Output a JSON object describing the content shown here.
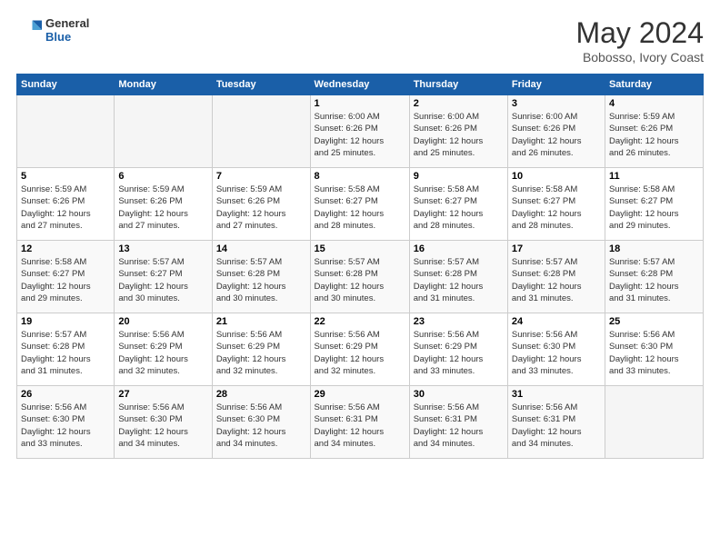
{
  "logo": {
    "general": "General",
    "blue": "Blue"
  },
  "header": {
    "month_year": "May 2024",
    "location": "Bobosso, Ivory Coast"
  },
  "days_of_week": [
    "Sunday",
    "Monday",
    "Tuesday",
    "Wednesday",
    "Thursday",
    "Friday",
    "Saturday"
  ],
  "weeks": [
    [
      {
        "day": "",
        "info": ""
      },
      {
        "day": "",
        "info": ""
      },
      {
        "day": "",
        "info": ""
      },
      {
        "day": "1",
        "info": "Sunrise: 6:00 AM\nSunset: 6:26 PM\nDaylight: 12 hours\nand 25 minutes."
      },
      {
        "day": "2",
        "info": "Sunrise: 6:00 AM\nSunset: 6:26 PM\nDaylight: 12 hours\nand 25 minutes."
      },
      {
        "day": "3",
        "info": "Sunrise: 6:00 AM\nSunset: 6:26 PM\nDaylight: 12 hours\nand 26 minutes."
      },
      {
        "day": "4",
        "info": "Sunrise: 5:59 AM\nSunset: 6:26 PM\nDaylight: 12 hours\nand 26 minutes."
      }
    ],
    [
      {
        "day": "5",
        "info": "Sunrise: 5:59 AM\nSunset: 6:26 PM\nDaylight: 12 hours\nand 27 minutes."
      },
      {
        "day": "6",
        "info": "Sunrise: 5:59 AM\nSunset: 6:26 PM\nDaylight: 12 hours\nand 27 minutes."
      },
      {
        "day": "7",
        "info": "Sunrise: 5:59 AM\nSunset: 6:26 PM\nDaylight: 12 hours\nand 27 minutes."
      },
      {
        "day": "8",
        "info": "Sunrise: 5:58 AM\nSunset: 6:27 PM\nDaylight: 12 hours\nand 28 minutes."
      },
      {
        "day": "9",
        "info": "Sunrise: 5:58 AM\nSunset: 6:27 PM\nDaylight: 12 hours\nand 28 minutes."
      },
      {
        "day": "10",
        "info": "Sunrise: 5:58 AM\nSunset: 6:27 PM\nDaylight: 12 hours\nand 28 minutes."
      },
      {
        "day": "11",
        "info": "Sunrise: 5:58 AM\nSunset: 6:27 PM\nDaylight: 12 hours\nand 29 minutes."
      }
    ],
    [
      {
        "day": "12",
        "info": "Sunrise: 5:58 AM\nSunset: 6:27 PM\nDaylight: 12 hours\nand 29 minutes."
      },
      {
        "day": "13",
        "info": "Sunrise: 5:57 AM\nSunset: 6:27 PM\nDaylight: 12 hours\nand 30 minutes."
      },
      {
        "day": "14",
        "info": "Sunrise: 5:57 AM\nSunset: 6:28 PM\nDaylight: 12 hours\nand 30 minutes."
      },
      {
        "day": "15",
        "info": "Sunrise: 5:57 AM\nSunset: 6:28 PM\nDaylight: 12 hours\nand 30 minutes."
      },
      {
        "day": "16",
        "info": "Sunrise: 5:57 AM\nSunset: 6:28 PM\nDaylight: 12 hours\nand 31 minutes."
      },
      {
        "day": "17",
        "info": "Sunrise: 5:57 AM\nSunset: 6:28 PM\nDaylight: 12 hours\nand 31 minutes."
      },
      {
        "day": "18",
        "info": "Sunrise: 5:57 AM\nSunset: 6:28 PM\nDaylight: 12 hours\nand 31 minutes."
      }
    ],
    [
      {
        "day": "19",
        "info": "Sunrise: 5:57 AM\nSunset: 6:28 PM\nDaylight: 12 hours\nand 31 minutes."
      },
      {
        "day": "20",
        "info": "Sunrise: 5:56 AM\nSunset: 6:29 PM\nDaylight: 12 hours\nand 32 minutes."
      },
      {
        "day": "21",
        "info": "Sunrise: 5:56 AM\nSunset: 6:29 PM\nDaylight: 12 hours\nand 32 minutes."
      },
      {
        "day": "22",
        "info": "Sunrise: 5:56 AM\nSunset: 6:29 PM\nDaylight: 12 hours\nand 32 minutes."
      },
      {
        "day": "23",
        "info": "Sunrise: 5:56 AM\nSunset: 6:29 PM\nDaylight: 12 hours\nand 33 minutes."
      },
      {
        "day": "24",
        "info": "Sunrise: 5:56 AM\nSunset: 6:30 PM\nDaylight: 12 hours\nand 33 minutes."
      },
      {
        "day": "25",
        "info": "Sunrise: 5:56 AM\nSunset: 6:30 PM\nDaylight: 12 hours\nand 33 minutes."
      }
    ],
    [
      {
        "day": "26",
        "info": "Sunrise: 5:56 AM\nSunset: 6:30 PM\nDaylight: 12 hours\nand 33 minutes."
      },
      {
        "day": "27",
        "info": "Sunrise: 5:56 AM\nSunset: 6:30 PM\nDaylight: 12 hours\nand 34 minutes."
      },
      {
        "day": "28",
        "info": "Sunrise: 5:56 AM\nSunset: 6:30 PM\nDaylight: 12 hours\nand 34 minutes."
      },
      {
        "day": "29",
        "info": "Sunrise: 5:56 AM\nSunset: 6:31 PM\nDaylight: 12 hours\nand 34 minutes."
      },
      {
        "day": "30",
        "info": "Sunrise: 5:56 AM\nSunset: 6:31 PM\nDaylight: 12 hours\nand 34 minutes."
      },
      {
        "day": "31",
        "info": "Sunrise: 5:56 AM\nSunset: 6:31 PM\nDaylight: 12 hours\nand 34 minutes."
      },
      {
        "day": "",
        "info": ""
      }
    ]
  ]
}
